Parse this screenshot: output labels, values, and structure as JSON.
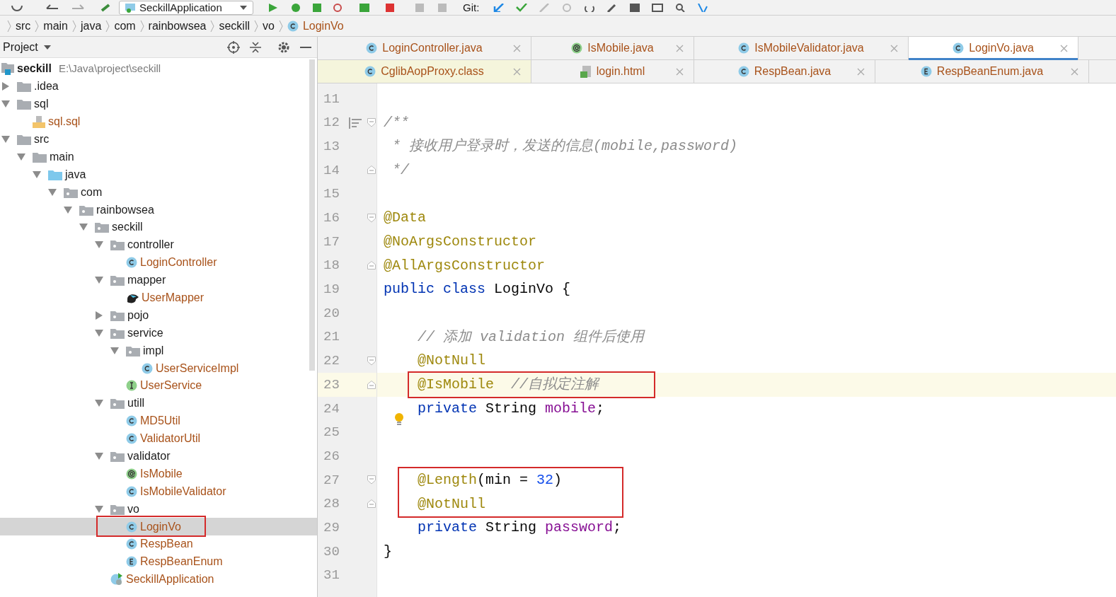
{
  "toolbar": {
    "run_config": "SeckillApplication",
    "git_label": "Git:"
  },
  "breadcrumbs": [
    {
      "text": "src",
      "kind": "folder"
    },
    {
      "text": "main",
      "kind": "folder"
    },
    {
      "text": "java",
      "kind": "folder"
    },
    {
      "text": "com",
      "kind": "folder"
    },
    {
      "text": "rainbowsea",
      "kind": "folder"
    },
    {
      "text": "seckill",
      "kind": "folder"
    },
    {
      "text": "vo",
      "kind": "folder"
    },
    {
      "text": "LoginVo",
      "kind": "class"
    }
  ],
  "project_panel": {
    "title": "Project",
    "tree": [
      {
        "label": "seckill",
        "path": "E:\\Java\\project\\seckill",
        "kind": "module",
        "selected": false,
        "children": [
          {
            "label": ".idea",
            "kind": "folder",
            "expanded": false,
            "selected": false
          },
          {
            "label": "sql",
            "kind": "folder",
            "expanded": true,
            "selected": false,
            "children": [
              {
                "label": "sql.sql",
                "kind": "sql",
                "selected": false
              }
            ]
          },
          {
            "label": "src",
            "kind": "folder",
            "expanded": true,
            "selected": false,
            "children": [
              {
                "label": "main",
                "kind": "folder",
                "expanded": true,
                "selected": false,
                "children": [
                  {
                    "label": "java",
                    "kind": "source",
                    "expanded": true,
                    "selected": false,
                    "children": [
                      {
                        "label": "com",
                        "kind": "package",
                        "expanded": true,
                        "selected": false,
                        "children": [
                          {
                            "label": "rainbowsea",
                            "kind": "package",
                            "expanded": true,
                            "selected": false,
                            "children": [
                              {
                                "label": "seckill",
                                "kind": "package",
                                "expanded": true,
                                "selected": false,
                                "children": [
                                  {
                                    "label": "controller",
                                    "kind": "package",
                                    "expanded": true,
                                    "selected": false,
                                    "children": [
                                      {
                                        "label": "LoginController",
                                        "kind": "class",
                                        "selected": false
                                      }
                                    ]
                                  },
                                  {
                                    "label": "mapper",
                                    "kind": "package",
                                    "expanded": true,
                                    "selected": false,
                                    "children": [
                                      {
                                        "label": "UserMapper",
                                        "kind": "mapper",
                                        "selected": false
                                      }
                                    ]
                                  },
                                  {
                                    "label": "pojo",
                                    "kind": "package",
                                    "expanded": false,
                                    "selected": false
                                  },
                                  {
                                    "label": "service",
                                    "kind": "package",
                                    "expanded": true,
                                    "selected": false,
                                    "children": [
                                      {
                                        "label": "impl",
                                        "kind": "package",
                                        "expanded": true,
                                        "selected": false,
                                        "children": [
                                          {
                                            "label": "UserServiceImpl",
                                            "kind": "class",
                                            "selected": false
                                          }
                                        ]
                                      },
                                      {
                                        "label": "UserService",
                                        "kind": "interface",
                                        "selected": false
                                      }
                                    ]
                                  },
                                  {
                                    "label": "utill",
                                    "kind": "package",
                                    "expanded": true,
                                    "selected": false,
                                    "children": [
                                      {
                                        "label": "MD5Util",
                                        "kind": "class",
                                        "selected": false
                                      },
                                      {
                                        "label": "ValidatorUtil",
                                        "kind": "class",
                                        "selected": false
                                      }
                                    ]
                                  },
                                  {
                                    "label": "validator",
                                    "kind": "package",
                                    "expanded": true,
                                    "selected": false,
                                    "children": [
                                      {
                                        "label": "IsMobile",
                                        "kind": "annotation",
                                        "selected": false
                                      },
                                      {
                                        "label": "IsMobileValidator",
                                        "kind": "class",
                                        "selected": false
                                      }
                                    ]
                                  },
                                  {
                                    "label": "vo",
                                    "kind": "package",
                                    "expanded": true,
                                    "selected": false,
                                    "children": [
                                      {
                                        "label": "LoginVo",
                                        "kind": "class",
                                        "selected": true,
                                        "boxed": true
                                      },
                                      {
                                        "label": "RespBean",
                                        "kind": "class",
                                        "selected": false
                                      },
                                      {
                                        "label": "RespBeanEnum",
                                        "kind": "enum",
                                        "selected": false
                                      }
                                    ]
                                  },
                                  {
                                    "label": "SeckillApplication",
                                    "kind": "app",
                                    "selected": false
                                  }
                                ]
                              }
                            ]
                          }
                        ]
                      }
                    ]
                  }
                ]
              }
            ]
          }
        ]
      }
    ]
  },
  "tab_rows": [
    [
      {
        "label": "LoginController.java",
        "kind": "class",
        "selected": false,
        "library": false
      },
      {
        "label": "IsMobile.java",
        "kind": "annotation",
        "selected": false,
        "library": false
      },
      {
        "label": "IsMobileValidator.java",
        "kind": "class",
        "selected": false,
        "library": false
      },
      {
        "label": "LoginVo.java",
        "kind": "class",
        "selected": true,
        "library": false
      }
    ],
    [
      {
        "label": "CglibAopProxy.class",
        "kind": "class",
        "selected": false,
        "library": true
      },
      {
        "label": "login.html",
        "kind": "html",
        "selected": false,
        "library": false
      },
      {
        "label": "RespBean.java",
        "kind": "class",
        "selected": false,
        "library": false
      },
      {
        "label": "RespBeanEnum.java",
        "kind": "enum",
        "selected": false,
        "library": false
      }
    ]
  ],
  "editor": {
    "lines": [
      {
        "number": "11"
      },
      {
        "number": "12",
        "fold_start": true,
        "doc": true,
        "tokens": [
          {
            "text": "/**",
            "kind": "comment"
          }
        ]
      },
      {
        "number": "13",
        "tokens": [
          {
            "text": " * 接收用户登录时，发送的信息(mobile,password)",
            "kind": "comment"
          }
        ]
      },
      {
        "number": "14",
        "fold_end": true,
        "tokens": [
          {
            "text": " */",
            "kind": "comment"
          }
        ]
      },
      {
        "number": "15"
      },
      {
        "number": "16",
        "fold_start": true,
        "tokens": [
          {
            "text": "@Data",
            "kind": "annotation"
          }
        ]
      },
      {
        "number": "17",
        "tokens": [
          {
            "text": "@NoArgsConstructor",
            "kind": "annotation"
          }
        ]
      },
      {
        "number": "18",
        "fold_end": true,
        "tokens": [
          {
            "text": "@AllArgsConstructor",
            "kind": "annotation"
          }
        ]
      },
      {
        "number": "19",
        "tokens": [
          {
            "text": "public class ",
            "kind": "keyword"
          },
          {
            "text": "LoginVo {",
            "kind": "plain"
          }
        ]
      },
      {
        "number": "20"
      },
      {
        "number": "21",
        "tokens": [
          {
            "text": "    // 添加 validation 组件后使用",
            "kind": "comment"
          }
        ]
      },
      {
        "number": "22",
        "fold_start": true,
        "tokens": [
          {
            "text": "    @NotNull",
            "kind": "annotation"
          }
        ]
      },
      {
        "number": "23",
        "fold_end": true,
        "current": true,
        "box_start": true,
        "box_end": true,
        "tokens": [
          {
            "text": "    @IsMobile",
            "kind": "annotation"
          },
          {
            "text": "  //自拟定注解",
            "kind": "comment"
          }
        ]
      },
      {
        "number": "24",
        "tokens": [
          {
            "text": "    private ",
            "kind": "keyword"
          },
          {
            "text": "String ",
            "kind": "plain"
          },
          {
            "text": "mobile",
            "kind": "field"
          },
          {
            "text": ";",
            "kind": "plain"
          }
        ]
      },
      {
        "number": "25"
      },
      {
        "number": "26"
      },
      {
        "number": "27",
        "fold_start": true,
        "box_start": true,
        "tokens": [
          {
            "text": "    @Length",
            "kind": "annotation"
          },
          {
            "text": "(min = ",
            "kind": "plain"
          },
          {
            "text": "32",
            "kind": "number"
          },
          {
            "text": ")",
            "kind": "plain"
          }
        ]
      },
      {
        "number": "28",
        "fold_end": true,
        "box_end": true,
        "tokens": [
          {
            "text": "    @NotNull",
            "kind": "annotation"
          }
        ]
      },
      {
        "number": "29",
        "tokens": [
          {
            "text": "    private ",
            "kind": "keyword"
          },
          {
            "text": "String ",
            "kind": "plain"
          },
          {
            "text": "password",
            "kind": "field"
          },
          {
            "text": ";",
            "kind": "plain"
          }
        ]
      },
      {
        "number": "30",
        "tokens": [
          {
            "text": "}",
            "kind": "plain"
          }
        ]
      },
      {
        "number": "31"
      }
    ]
  }
}
